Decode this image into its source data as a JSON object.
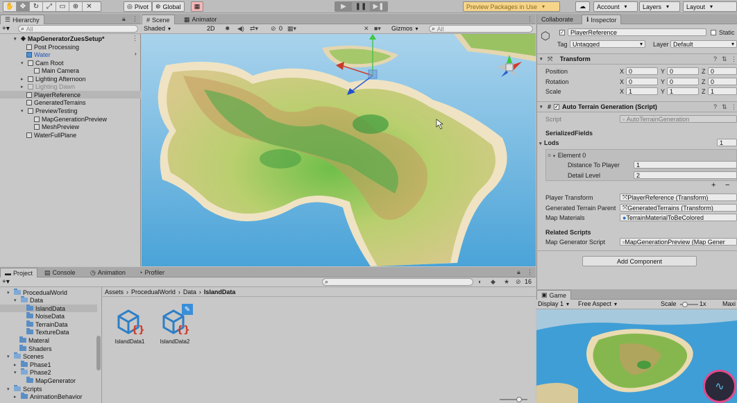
{
  "toolbar": {
    "pivot": "Pivot",
    "global": "Global",
    "preview": "Preview Packages in Use",
    "account": "Account",
    "layers": "Layers",
    "layout": "Layout"
  },
  "hierarchy": {
    "tab": "Hierarchy",
    "search_placeholder": "All",
    "scene": "MapGeneratorZuesSetup*",
    "items": [
      "Post Processing",
      "Water",
      "Cam Root",
      "Main Camera",
      "Lighting Afternoon",
      "Lighting Dawn",
      "PlayerReference",
      "GeneratedTerrains",
      "PreviewTesting",
      "MapGenerationPreview",
      "MeshPreview",
      "WaterFullPlane"
    ]
  },
  "scene_view": {
    "tabs": [
      "Scene",
      "Animator"
    ],
    "shading": "Shaded",
    "mode_2d": "2D",
    "hidden_count": "0",
    "gizmos": "Gizmos",
    "search_placeholder": "All"
  },
  "inspector": {
    "tabs": [
      "Collaborate",
      "Inspector"
    ],
    "object_name": "PlayerReference",
    "static": "Static",
    "tag_label": "Tag",
    "tag_value": "Untagged",
    "layer_label": "Layer",
    "layer_value": "Default",
    "transform": {
      "title": "Transform",
      "rows": [
        {
          "label": "Position",
          "x": "0",
          "y": "0",
          "z": "0"
        },
        {
          "label": "Rotation",
          "x": "0",
          "y": "0",
          "z": "0"
        },
        {
          "label": "Scale",
          "x": "1",
          "y": "1",
          "z": "1"
        }
      ]
    },
    "component": {
      "title": "Auto Terrain Generation (Script)",
      "script_label": "Script",
      "script_value": "AutoTerrainGeneration",
      "serialized": "SerializedFields",
      "lods_label": "Lods",
      "lods_count": "1",
      "element": "Element 0",
      "distance_label": "Distance To Player",
      "distance_value": "1",
      "detail_label": "Detail Level",
      "detail_value": "2",
      "player_transform_label": "Player Transform",
      "player_transform_value": "PlayerReference (Transform)",
      "generated_parent_label": "Generated Terrain Parent",
      "generated_parent_value": "GeneratedTerrains (Transform)",
      "materials_label": "Map Materials",
      "materials_value": "TerrainMaterialToBeColored",
      "related": "Related Scripts",
      "map_gen_label": "Map Generator Script",
      "map_gen_value": "MapGenerationPreview (Map Gener"
    },
    "add_component": "Add Component"
  },
  "game": {
    "tab": "Game",
    "display": "Display 1",
    "aspect": "Free Aspect",
    "scale_label": "Scale",
    "scale_value": "1x",
    "maximize": "Maxi"
  },
  "project": {
    "tabs": [
      "Project",
      "Console",
      "Animation",
      "Profiler"
    ],
    "count": "16",
    "breadcrumb": [
      "Assets",
      "ProcedualWorld",
      "Data",
      "IslandData"
    ],
    "tree": [
      "ProcedualWorld",
      "Data",
      "IslandData",
      "NoiseData",
      "TerrainData",
      "TextureData",
      "Materal",
      "Shaders",
      "Scenes",
      "Phase1",
      "Phase2",
      "MapGenerator",
      "Scripts",
      "AnimationBehavior"
    ],
    "assets": [
      "IslandData1",
      "IslandData2"
    ]
  }
}
